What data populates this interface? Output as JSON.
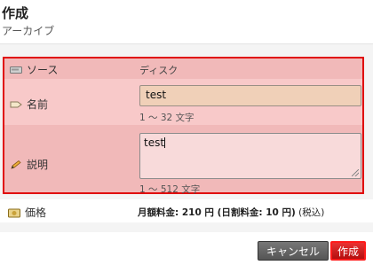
{
  "header": {
    "title": "作成",
    "subtitle": "アーカイブ"
  },
  "form": {
    "source": {
      "label": "ソース",
      "value": "ディスク",
      "icon": "disk-icon"
    },
    "name": {
      "label": "名前",
      "value": "test",
      "hint": "1 〜 32 文字",
      "icon": "tag-icon"
    },
    "description": {
      "label": "説明",
      "value": "test",
      "hint": "1 〜 512 文字",
      "icon": "pencil-icon"
    }
  },
  "price": {
    "label": "価格",
    "icon": "price-icon",
    "monthly_text": "月額料金: 210 円 (日割料金: 10 円)",
    "tax_text": " (税込)"
  },
  "buttons": {
    "cancel": "キャンセル",
    "create": "作成"
  },
  "colors": {
    "highlight_border": "#e00b0b",
    "create_button": "#c81a1a",
    "cancel_button": "#666666"
  }
}
